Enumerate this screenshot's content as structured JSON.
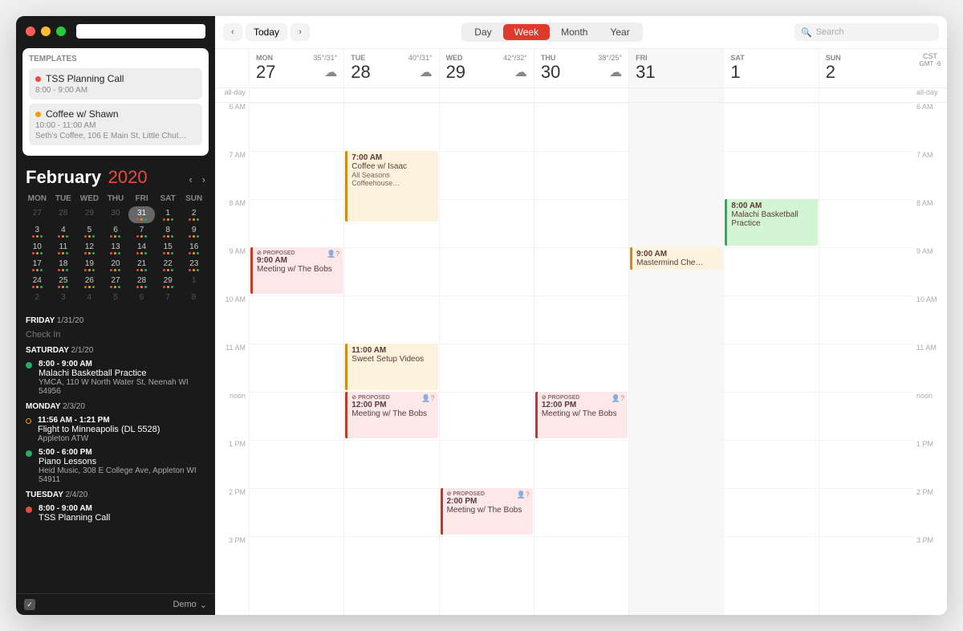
{
  "sidebar": {
    "templates_header": "TEMPLATES",
    "templates": [
      {
        "title": "TSS Planning Call",
        "time": "8:00 - 9:00 AM",
        "color": "#e74c3c"
      },
      {
        "title": "Coffee w/ Shawn",
        "time": "10:00 - 11:00 AM",
        "loc": "Seth's Coffee, 106 E Main St, Little Chut…",
        "color": "#f39c12"
      }
    ],
    "month": "February",
    "year": "2020",
    "weekdays": [
      "MON",
      "TUE",
      "WED",
      "THU",
      "FRI",
      "SAT",
      "SUN"
    ],
    "weeks": [
      [
        "27",
        "28",
        "29",
        "30",
        "31",
        "1",
        "2"
      ],
      [
        "3",
        "4",
        "5",
        "6",
        "7",
        "8",
        "9"
      ],
      [
        "10",
        "11",
        "12",
        "13",
        "14",
        "15",
        "16"
      ],
      [
        "17",
        "18",
        "19",
        "20",
        "21",
        "22",
        "23"
      ],
      [
        "24",
        "25",
        "26",
        "27",
        "28",
        "29",
        "1"
      ],
      [
        "2",
        "3",
        "4",
        "5",
        "6",
        "7",
        "8"
      ]
    ],
    "selected": "31",
    "agenda": [
      {
        "day": "FRIDAY",
        "date": "1/31/20",
        "items": [
          {
            "title": "Check In",
            "time": "",
            "color": ""
          }
        ],
        "cut": true
      },
      {
        "day": "SATURDAY",
        "date": "2/1/20",
        "items": [
          {
            "time": "8:00 - 9:00 AM",
            "title": "Malachi Basketball Practice",
            "loc": "YMCA, 110 W North Water St, Neenah WI 54956",
            "color": "#27ae60"
          }
        ]
      },
      {
        "day": "MONDAY",
        "date": "2/3/20",
        "items": [
          {
            "time": "11:56 AM - 1:21 PM",
            "title": "Flight to Minneapolis (DL 5528)",
            "loc": "Appleton ATW",
            "color": "#f39c12",
            "ring": true
          },
          {
            "time": "5:00 - 6:00 PM",
            "title": "Piano Lessons",
            "loc": "Heid Music, 308 E College Ave, Appleton WI 54911",
            "color": "#27ae60"
          }
        ]
      },
      {
        "day": "TUESDAY",
        "date": "2/4/20",
        "items": [
          {
            "time": "8:00 - 9:00 AM",
            "title": "TSS Planning Call",
            "color": "#e74c3c"
          }
        ]
      }
    ],
    "footer": "Demo"
  },
  "toolbar": {
    "today": "Today",
    "views": [
      "Day",
      "Week",
      "Month",
      "Year"
    ],
    "active": "Week",
    "search_placeholder": "Search"
  },
  "tz": {
    "label": "CST",
    "offset": "GMT -6"
  },
  "allday_label": "all-day",
  "hours": [
    "6 AM",
    "7 AM",
    "8 AM",
    "9 AM",
    "10 AM",
    "11 AM",
    "noon",
    "1 PM",
    "2 PM",
    "3 PM"
  ],
  "days": [
    {
      "name": "MON",
      "num": "27",
      "temp": "35°/31°",
      "cloud": true,
      "shade": false
    },
    {
      "name": "TUE",
      "num": "28",
      "temp": "40°/31°",
      "cloud": true,
      "shade": false
    },
    {
      "name": "WED",
      "num": "29",
      "temp": "42°/32°",
      "cloud": true,
      "shade": false
    },
    {
      "name": "THU",
      "num": "30",
      "temp": "38°/25°",
      "cloud": true,
      "shade": false
    },
    {
      "name": "FRI",
      "num": "31",
      "temp": "",
      "cloud": false,
      "shade": true
    },
    {
      "name": "SAT",
      "num": "1",
      "temp": "",
      "cloud": false,
      "shade": false
    },
    {
      "name": "SUN",
      "num": "2",
      "temp": "",
      "cloud": false,
      "shade": false
    }
  ],
  "events": [
    {
      "day": 0,
      "start": 9,
      "dur": 1,
      "time": "9:00 AM",
      "title": "Meeting w/ The Bobs",
      "proposed": true,
      "people": true,
      "bg": "#fce8e8",
      "border": "#c0392b"
    },
    {
      "day": 1,
      "start": 7,
      "dur": 1.5,
      "time": "7:00 AM",
      "title": "Coffee w/ Isaac",
      "loc": "All Seasons Coffeehouse…",
      "bg": "#fdf3dc",
      "border": "#d68910"
    },
    {
      "day": 1,
      "start": 11,
      "dur": 1,
      "time": "11:00 AM",
      "title": "Sweet Setup Videos",
      "bg": "#fdf3dc",
      "border": "#d68910"
    },
    {
      "day": 1,
      "start": 12,
      "dur": 1,
      "time": "12:00 PM",
      "title": "Meeting w/ The Bobs",
      "proposed": true,
      "people": true,
      "bg": "#fce8e8",
      "border": "#c0392b"
    },
    {
      "day": 2,
      "start": 14,
      "dur": 1,
      "time": "2:00 PM",
      "title": "Meeting w/ The Bobs",
      "proposed": true,
      "people": true,
      "bg": "#fce8e8",
      "border": "#c0392b"
    },
    {
      "day": 3,
      "start": 12,
      "dur": 1,
      "time": "12:00 PM",
      "title": "Meeting w/ The Bobs",
      "proposed": true,
      "people": true,
      "bg": "#fce8e8",
      "border": "#c0392b"
    },
    {
      "day": 4,
      "start": 9,
      "dur": 0.5,
      "time": "9:00 AM",
      "title": "Mastermind Che…",
      "bg": "#fdf3dc",
      "border": "#d68910"
    },
    {
      "day": 5,
      "start": 8,
      "dur": 1,
      "time": "8:00 AM",
      "title": "Malachi Basketball Practice",
      "bg": "#d4f5d4",
      "border": "#27ae60"
    }
  ]
}
